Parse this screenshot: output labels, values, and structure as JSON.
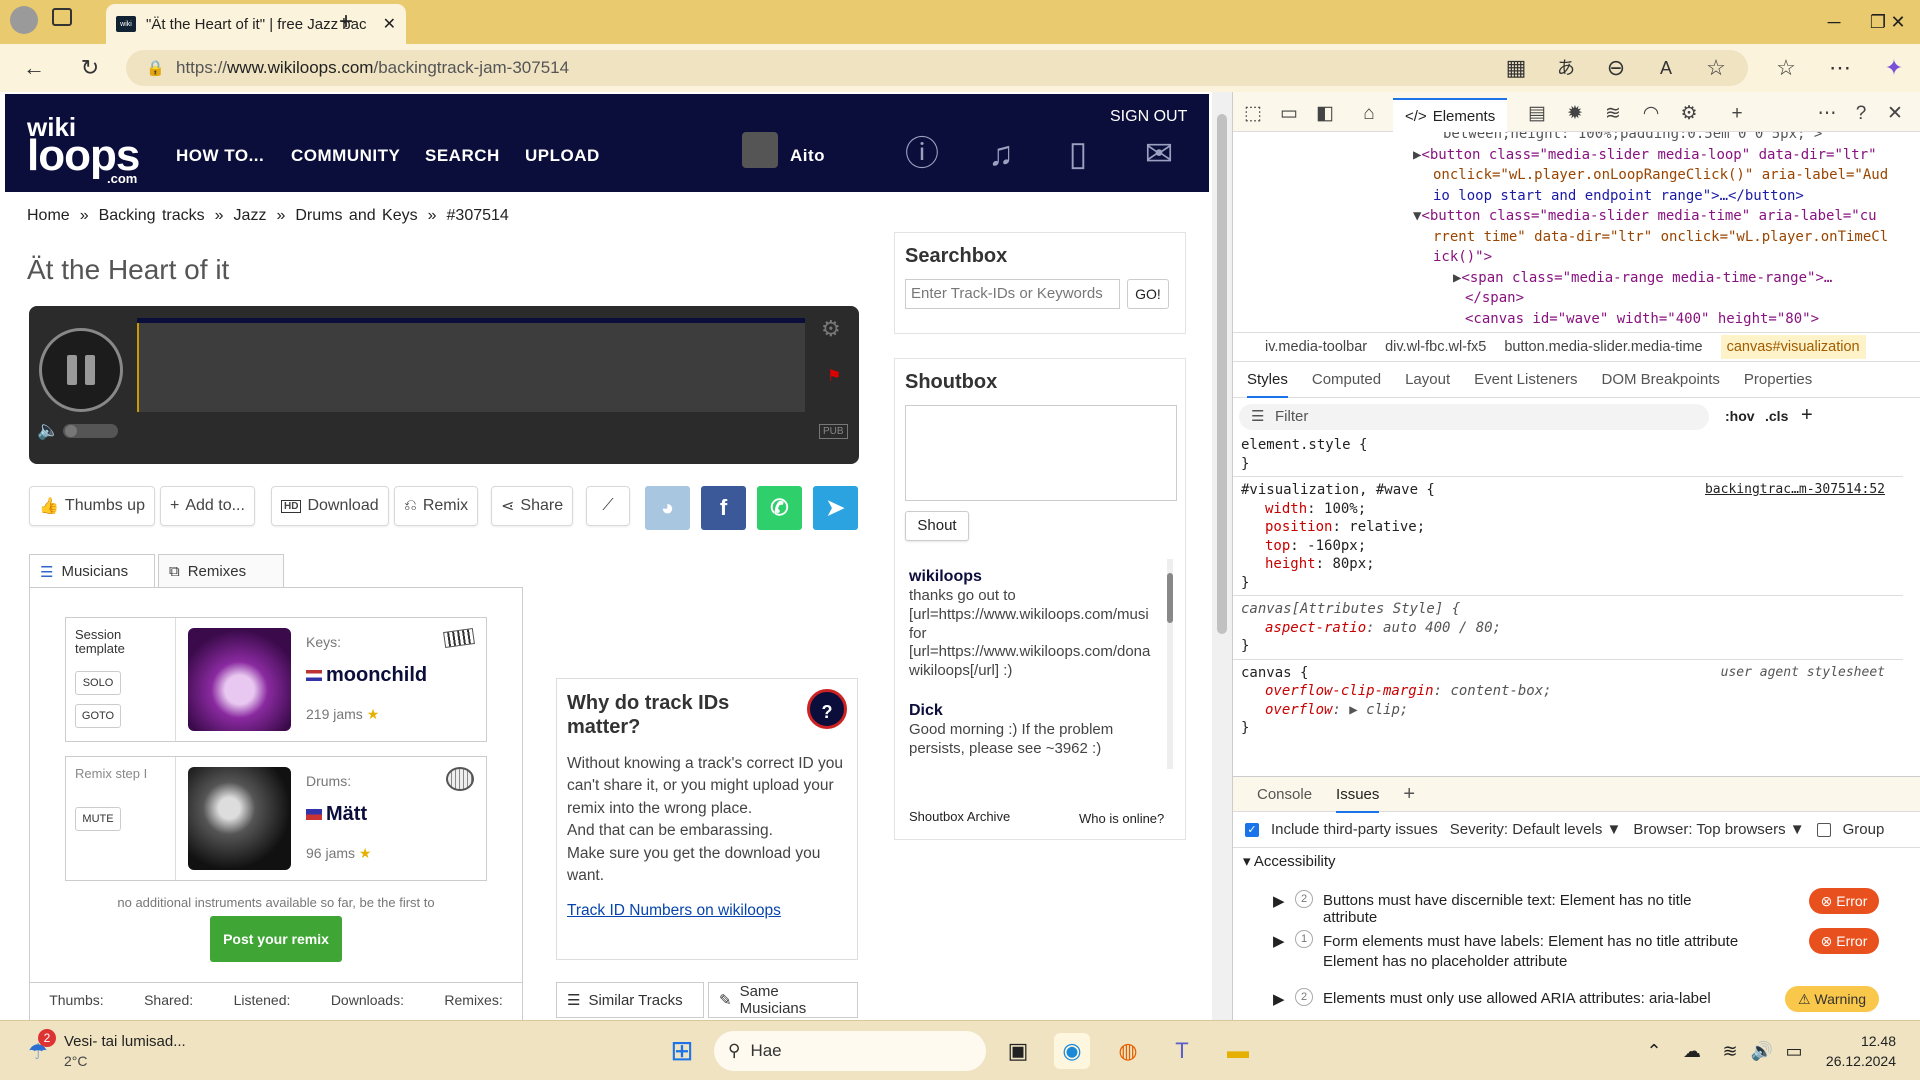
{
  "browser": {
    "tab_title": "\"Ät the Heart of it\" | free Jazz bac",
    "url_prefix": "https://",
    "url_domain": "www.wikiloops.com",
    "url_path": "/backingtrack-jam-307514"
  },
  "site": {
    "logo_top": "wiki",
    "logo_main": "loops",
    "logo_suffix": ".com",
    "nav": [
      "HOW TO...",
      "COMMUNITY",
      "SEARCH",
      "UPLOAD"
    ],
    "sign_out": "SIGN OUT",
    "user": "Aito"
  },
  "breadcrumb": [
    "Home",
    "Backing tracks",
    "Jazz",
    "Drums and Keys",
    "#307514"
  ],
  "breadcrumb_sep": "»",
  "track_title": "Ät the Heart of it",
  "player": {
    "badge": "PUB"
  },
  "actions": [
    "Thumbs up",
    "Add to...",
    "Download",
    "Remix",
    "Share"
  ],
  "social": [
    "reddit",
    "facebook",
    "whatsapp",
    "telegram"
  ],
  "tabs": [
    "Musicians",
    "Remixes"
  ],
  "musicians": [
    {
      "side_label": "Session template",
      "buttons": [
        "SOLO",
        "GOTO"
      ],
      "role": "Keys:",
      "name": "moonchild",
      "jams": "219 jams"
    },
    {
      "side_label": "Remix step I",
      "buttons": [
        "MUTE"
      ],
      "role": "Drums:",
      "name": "Mätt",
      "jams": "96 jams"
    }
  ],
  "no_more_text": "no additional instruments available so far, be the first to",
  "post_remix": "Post your remix",
  "stats": [
    "Thumbs:",
    "Shared:",
    "Listened:",
    "Downloads:",
    "Remixes:"
  ],
  "why": {
    "title": "Why do track IDs matter?",
    "text1": "Without knowing a track's correct ID you can't share it, or you might upload your remix into the wrong place.",
    "text2": "And that can be embarassing.",
    "text3": "Make sure you get the download you want.",
    "link": "Track ID Numbers on wikiloops"
  },
  "similar": [
    "Similar Tracks",
    "Same Musicians"
  ],
  "searchbox": {
    "title": "Searchbox",
    "placeholder": "Enter Track-IDs or Keywords",
    "go": "GO!"
  },
  "shoutbox": {
    "title": "Shoutbox",
    "shout": "Shout",
    "messages": [
      {
        "user": "wikiloops",
        "text": "thanks go out to [url=https://www.wikiloops.com/musi for [url=https://www.wikiloops.com/dona wikiloops[/url] :)"
      },
      {
        "user": "Dick",
        "text": "Good morning :) If the problem persists, please see ~3962 :)"
      }
    ],
    "archive": "Shoutbox Archive",
    "online": "Who is online?"
  },
  "devtools": {
    "active_tab": "Elements",
    "code_lines": [
      "between;height: 100%;padding:0.5em 0 0 5px;\">",
      "<button class=\"media-slider media-loop\" data-dir=\"ltr\"",
      "onclick=\"wL.player.onLoopRangeClick()\" aria-label=\"Aud",
      "io loop start and endpoint range\">…</button>",
      "<button class=\"media-slider media-time\" aria-label=\"cu",
      "rrent time\" data-dir=\"ltr\" onclick=\"wL.player.onTimeCl",
      "ick()\">",
      "<span class=\"media-range media-time-range\">…",
      "</span>",
      "<canvas id=\"wave\" width=\"400\" height=\"80\">"
    ],
    "crumbs": [
      "iv.media-toolbar",
      "div.wl-fbc.wl-fx5",
      "button.media-slider.media-time",
      "canvas#visualization"
    ],
    "style_tabs": [
      "Styles",
      "Computed",
      "Layout",
      "Event Listeners",
      "DOM Breakpoints",
      "Properties"
    ],
    "filter": "Filter",
    "hov": ":hov",
    "cls": ".cls",
    "rules": {
      "element_style": "element.style {",
      "close": "}",
      "sel1": "#visualization, #wave {",
      "src1": "backingtrac…m-307514:52",
      "props1": [
        [
          "width",
          "100%;"
        ],
        [
          "position",
          "relative;"
        ],
        [
          "top",
          "-160px;"
        ],
        [
          "height",
          "80px;"
        ]
      ],
      "sel2": "canvas[Attributes Style] {",
      "props2": [
        [
          "aspect-ratio",
          "auto 400 / 80;"
        ]
      ],
      "sel3": "canvas {",
      "src3": "user agent stylesheet",
      "props3": [
        [
          "overflow-clip-margin",
          "content-box;"
        ],
        [
          "overflow",
          "▶ clip;"
        ]
      ]
    },
    "drawer_tabs": [
      "Console",
      "Issues"
    ],
    "issues_bar": {
      "include": "Include third-party issues",
      "severity": "Severity: Default levels",
      "browser": "Browser: Top browsers",
      "group": "Group"
    },
    "section": "Accessibility",
    "issues": [
      {
        "count": "2",
        "text": "Buttons must have discernible text: Element has no title attribute",
        "level": "Error"
      },
      {
        "count": "1",
        "text": "Form elements must have labels: Element has no title attribute Element has no placeholder attribute",
        "level": "Error"
      },
      {
        "count": "2",
        "text": "Elements must only use allowed ARIA attributes: aria-label",
        "level": "Warning"
      }
    ]
  },
  "taskbar": {
    "weather_badge": "2",
    "weather_desc": "Vesi- tai lumisad...",
    "weather_temp": "2°C",
    "search": "Hae",
    "time": "12.48",
    "date": "26.12.2024"
  }
}
